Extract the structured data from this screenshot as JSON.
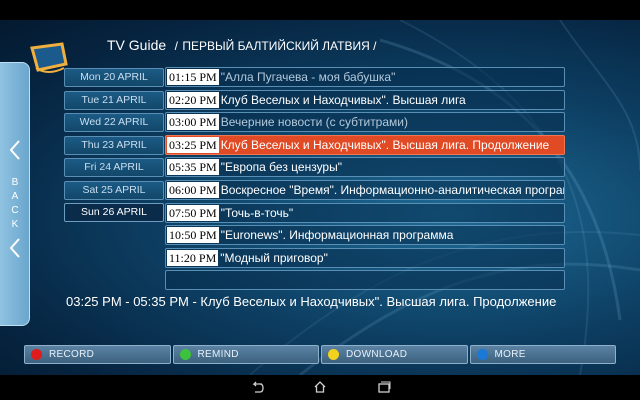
{
  "header": {
    "title": "TV Guide",
    "separator": "/",
    "channel": "ПЕРВЫЙ БАЛТИЙСКИЙ ЛАТВИЯ /"
  },
  "back": {
    "letters": [
      "B",
      "A",
      "C",
      "K"
    ]
  },
  "days": [
    {
      "label": "Mon 20 APRIL",
      "selected": false
    },
    {
      "label": "Tue 21 APRIL",
      "selected": false
    },
    {
      "label": "Wed 22 APRIL",
      "selected": false
    },
    {
      "label": "Thu 23 APRIL",
      "selected": false
    },
    {
      "label": "Fri 24 APRIL",
      "selected": false
    },
    {
      "label": "Sat 25 APRIL",
      "selected": false
    },
    {
      "label": "Sun 26 APRIL",
      "selected": true
    }
  ],
  "programs": [
    {
      "time": "01:15 PM",
      "title": "\"Алла Пугачева - моя бабушка\"",
      "active": false,
      "dim": true
    },
    {
      "time": "02:20 PM",
      "title": "Клуб Веселых и Находчивых\". Высшая лига",
      "active": false,
      "dim": false
    },
    {
      "time": "03:00 PM",
      "title": "Вечерние новости (с субтитрами)",
      "active": false,
      "dim": true
    },
    {
      "time": "03:25 PM",
      "title": "Клуб Веселых и Находчивых\". Высшая лига. Продолжение",
      "active": true,
      "dim": false
    },
    {
      "time": "05:35 PM",
      "title": "\"Европа без цензуры\"",
      "active": false,
      "dim": false
    },
    {
      "time": "06:00 PM",
      "title": "Воскресное \"Время\". Информационно-аналитическая программа",
      "active": false,
      "dim": false
    },
    {
      "time": "07:50 PM",
      "title": "\"Точь-в-точь\"",
      "active": false,
      "dim": false
    },
    {
      "time": "10:50 PM",
      "title": "\"Euronews\". Информационная программа",
      "active": false,
      "dim": false
    },
    {
      "time": "11:20 PM",
      "title": "\"Модный приговор\"",
      "active": false,
      "dim": false
    },
    {
      "time": "",
      "title": "",
      "active": false,
      "dim": false
    }
  ],
  "detail": {
    "text": "03:25 PM - 05:35 PM - Клуб Веселых и Находчивых\". Высшая лига. Продолжение"
  },
  "buttons": [
    {
      "label": "RECORD",
      "color": "#e01b1b"
    },
    {
      "label": "REMIND",
      "color": "#3cc23c"
    },
    {
      "label": "DOWNLOAD",
      "color": "#f2d21b"
    },
    {
      "label": "MORE",
      "color": "#1a78d6"
    }
  ],
  "colors": {
    "accent_active": "#e04a24",
    "background": "#0d3f63"
  },
  "navbar": {
    "icons": [
      "back-icon",
      "home-icon",
      "recent-apps-icon"
    ]
  }
}
